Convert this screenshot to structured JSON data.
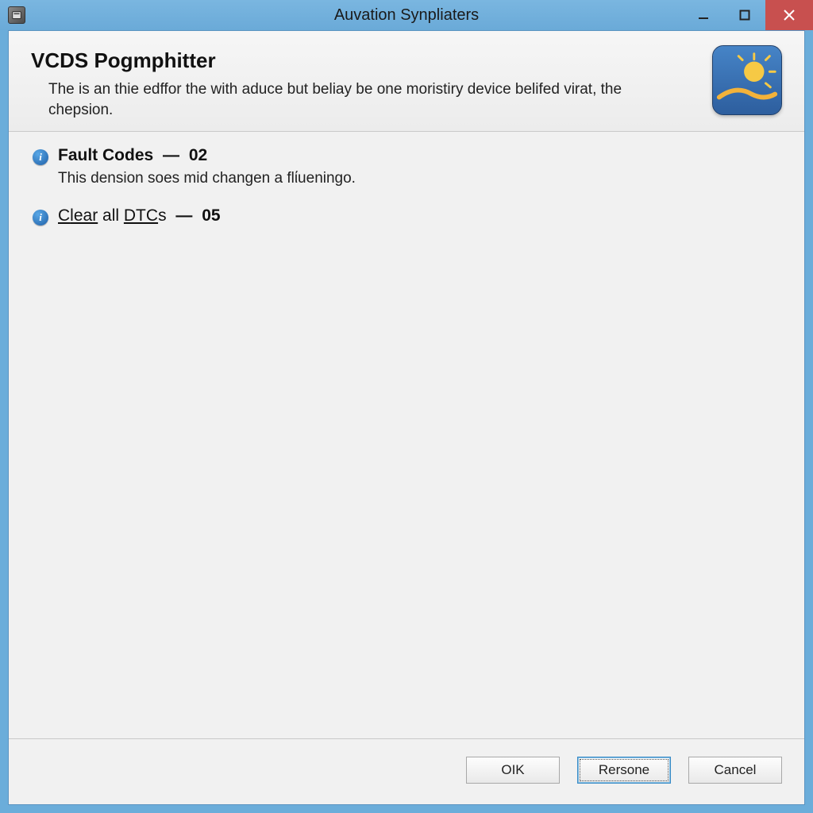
{
  "titlebar": {
    "title": "Auvation Synpliaters"
  },
  "header": {
    "title": "VCDS Pogmphitter",
    "description": "The is an thie edffor the with aduce but beliay be one moristiry device belifed virat, the chepsion."
  },
  "items": [
    {
      "title_bold": "Fault Codes",
      "dash": "—",
      "code": "02",
      "description": "This dension soes mid changen a flίueningo.",
      "link": false
    },
    {
      "title_prefix_underline": "C",
      "title_prefix_rest": "lear",
      "title_middle": " all ",
      "title_dtc_underline": "DTC",
      "title_suffix": "s",
      "dash": "—",
      "code": "05",
      "description": "",
      "link": true
    }
  ],
  "footer": {
    "ok": "OIK",
    "default": "Rersone",
    "cancel": "Cancel"
  },
  "icons": {
    "info_glyph": "i"
  }
}
